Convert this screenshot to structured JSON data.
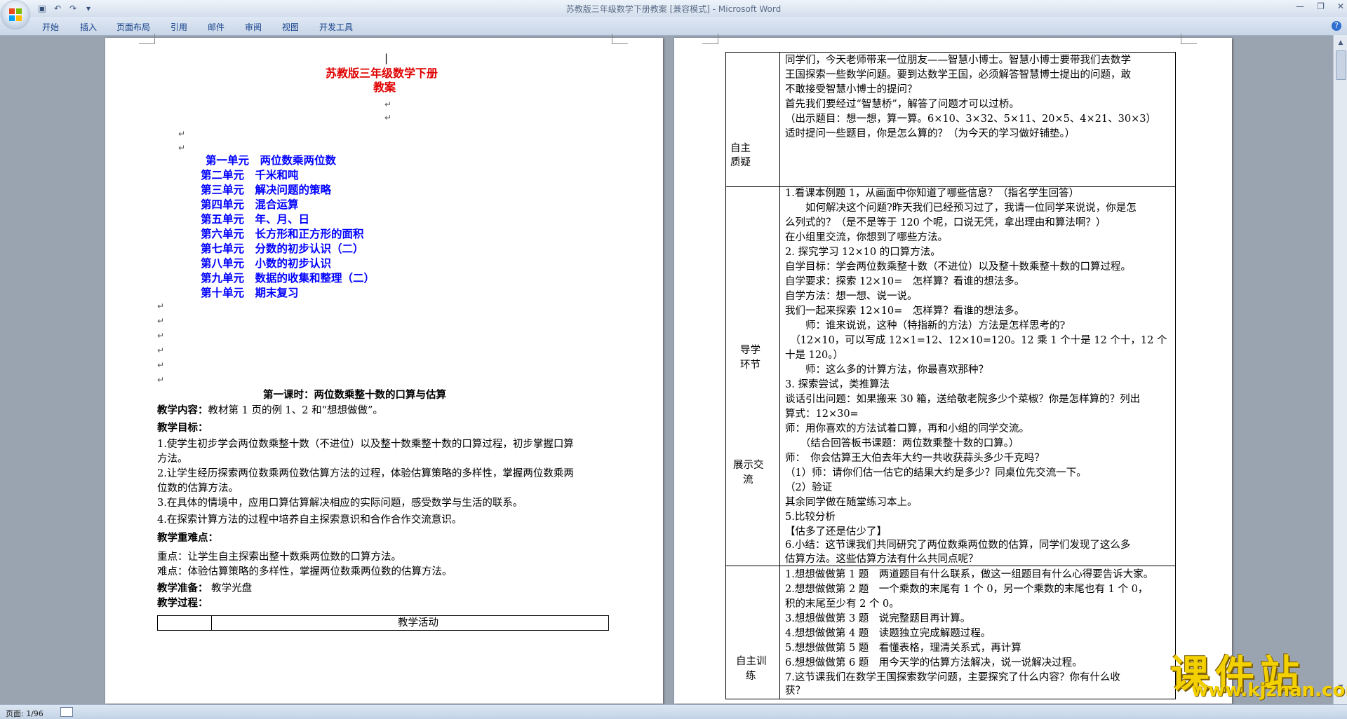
{
  "window": {
    "title": "苏教版三年级数学下册教案 [兼容模式] - Microsoft Word"
  },
  "ribbon": {
    "tabs": [
      "开始",
      "插入",
      "页面布局",
      "引用",
      "邮件",
      "审阅",
      "视图",
      "开发工具"
    ]
  },
  "status": {
    "page": "页面: 1/96"
  },
  "page1": {
    "title1": "苏教版三年级数学下册",
    "title2": "教案",
    "units": [
      "第一单元　两位数乘两位数",
      "第二单元　千米和吨",
      "第三单元　解决问题的策略",
      "第四单元　混合运算",
      "第五单元　年、月、日",
      "第六单元　长方形和正方形的面积",
      "第七单元　分数的初步认识（二）",
      "第八单元　小数的初步认识",
      "第九单元　数据的收集和整理（二）",
      "第十单元　期末复习"
    ],
    "lesson_title": "第一课时：两位数乘整十数的口算与估算",
    "content_label": "教学内容：",
    "content_text": "教材第 1 页的例 1、2 和“想想做做”。",
    "goals_label": "教学目标：",
    "goals": [
      "1.使学生初步学会两位数乘整十数（不进位）以及整十数乘整十数的口算过程，初步掌握口算",
      "方法。",
      "2.让学生经历探索两位数乘两位数估算方法的过程，体验估算策略的多样性，掌握两位数乘两",
      "位数的估算方法。",
      "3.在具体的情境中，应用口算估算解决相应的实际问题，感受数学与生活的联系。",
      "4.在探索计算方法的过程中培养自主探索意识和合作合作交流意识。"
    ],
    "key_label": "教学重难点：",
    "key_points": [
      "重点：让学生自主探索出整十数乘两位数的口算方法。",
      "难点：体验估算策略的多样性，掌握两位数乘两位数的估算方法。"
    ],
    "prep_label": "教学准备：",
    "prep_text": " 教学光盘",
    "process_label": "教学过程：",
    "table_header": "教学活动"
  },
  "page2": {
    "row1_label": [
      "自主",
      "质疑"
    ],
    "row1_lines": [
      "同学们，今天老师带来一位朋友——智慧小博士。智慧小博士要带我们去数学",
      "王国探索一些数学问题。要到达数学王国，必须解答智慧博士提出的问题，敢",
      "不敢接受智慧小博士的提问？",
      "首先我们要经过“智慧桥”，解答了问题才可以过桥。",
      "（出示题目：想一想，算一算。6×10、3×32、5×11、20×5、4×21、30×3）",
      "适时提问一些题目，你是怎么算的？（为今天的学习做好铺垫。）"
    ],
    "row2_label_a": [
      "导学",
      "环节"
    ],
    "row2_label_b": [
      "展示交",
      "流"
    ],
    "row2_lines": [
      "1.看课本例题 1，从画面中你知道了哪些信息？（指名学生回答）",
      "　　如何解决这个问题?昨天我们已经预习过了，我请一位同学来说说，你是怎",
      "么列式的？（是不是等于 120 个呢，口说无凭，拿出理由和算法啊？）",
      "在小组里交流，你想到了哪些方法。",
      "2. 探究学习 12×10 的口算方法。",
      "自学目标：学会两位数乘整十数（不进位）以及整十数乘整十数的口算过程。",
      "自学要求：探索 12×10=　怎样算？看谁的想法多。",
      "自学方法：想一想、说一说。",
      "我们一起来探索 12×10=　怎样算？看谁的想法多。",
      "　　师：谁来说说，这种（特指新的方法）方法是怎样思考的?",
      "　（12×10，可以写成 12×1=12、12×10=120。12 乘 1 个十是 12 个十，12 个",
      "十是 120。）",
      "　　师：这么多的计算方法，你最喜欢那种？",
      "3. 探索尝试，类推算法",
      "谈话引出问题：如果搬来 30 箱，送给敬老院多少个菜椒？你是怎样算的？列出",
      "算式：12×30=",
      "师：用你喜欢的方法试着口算，再和小组的同学交流。",
      "　　（结合回答板书课题：两位数乘整十数的口算。）",
      "师：　你会估算王大伯去年大约一共收获蒜头多少千克吗？",
      "（1）师：请你们估一估它的结果大约是多少？同桌位先交流一下。",
      "（2）验证",
      "其余同学做在随堂练习本上。",
      "5.比较分析",
      "【估多了还是估少了】",
      "6.小结：这节课我们共同研究了两位数乘两位数的估算，同学们发现了这么多",
      "估算方法。这些估算方法有什么共同点呢？"
    ],
    "row3_label": [
      "自主训",
      "练"
    ],
    "row3_lines": [
      "1.想想做做第 1 题　两道题目有什么联系，做这一组题目有什么心得要告诉大家。",
      "2.想想做做第 2 题　一个乘数的末尾有 1 个 0，另一个乘数的末尾也有 1 个 0，",
      "积的末尾至少有 2 个 0。",
      "3.想想做做第 3 题　说完整题目再计算。",
      "4.想想做做第 4 题　读题独立完成解题过程。",
      "5.想想做做第 5 题　看懂表格，理清关系式，再计算",
      "6.想想做做第 6 题　用今天学的估算方法解决，说一说解决过程。",
      "7.这节课我们在数学王国探索数学问题，主要探究了什么内容？你有什么收",
      "获？"
    ]
  },
  "watermark": {
    "cn": "课件站",
    "en": "www.kjzhan.com"
  }
}
